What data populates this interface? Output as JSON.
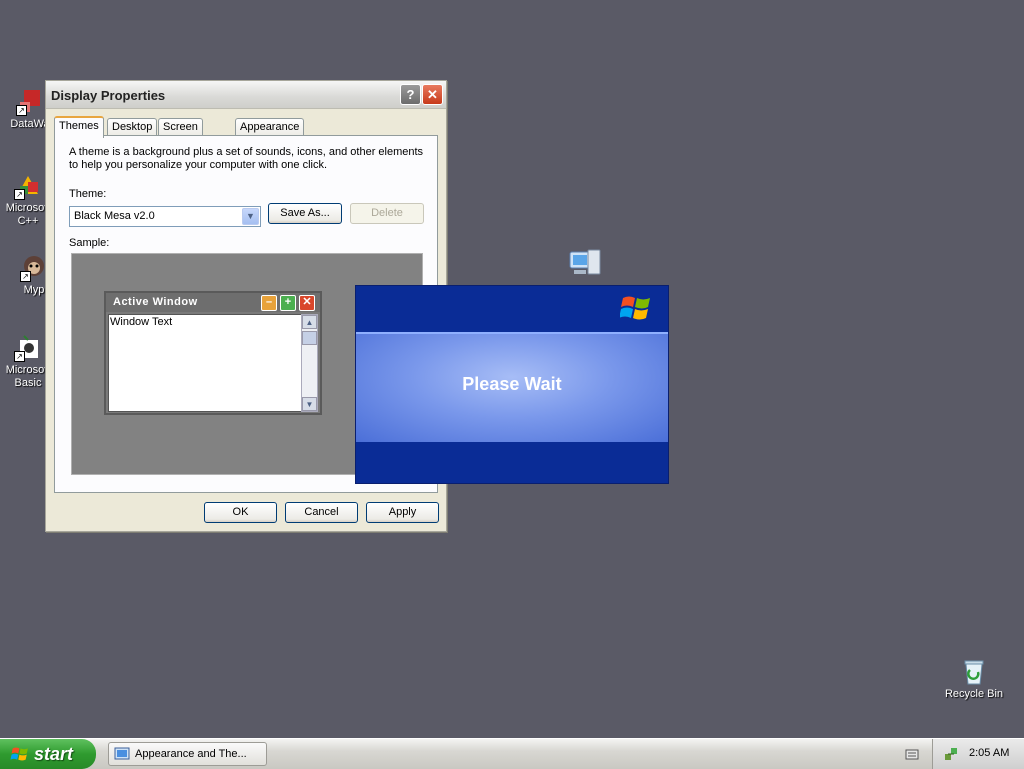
{
  "desktop": {
    "icons": [
      {
        "label": "DataWa"
      },
      {
        "label": "Microsoft C++"
      },
      {
        "label": "Myp"
      },
      {
        "label": "Microsoft Basic"
      }
    ],
    "recycle_bin": {
      "label": "Recycle Bin"
    }
  },
  "dialog": {
    "title": "Display Properties",
    "help_glyph": "?",
    "close_glyph": "✕",
    "tabs": [
      "Themes",
      "Desktop",
      "Screen Saver",
      "Appearance"
    ],
    "active_tab": "Themes",
    "description_line1": "A theme is a background plus a set of sounds, icons, and other elements",
    "description_line2": "to help you personalize your computer with one click.",
    "theme_label": "Theme:",
    "theme_value": "Black Mesa v2.0",
    "save_as_label": "Save As...",
    "delete_label": "Delete",
    "sample_label": "Sample:",
    "sample": {
      "active_window_title": "Active Window",
      "window_text": "Window Text"
    },
    "ok_label": "OK",
    "cancel_label": "Cancel",
    "apply_label": "Apply"
  },
  "splash": {
    "message": "Please Wait"
  },
  "taskbar": {
    "start_label": "start",
    "task_item_label": "Appearance and The...",
    "clock": "2:05 AM"
  },
  "colors": {
    "desktop_bg": "#5a5a66",
    "splash_blue": "#0b2e98",
    "start_green": "#2f9b2f"
  }
}
